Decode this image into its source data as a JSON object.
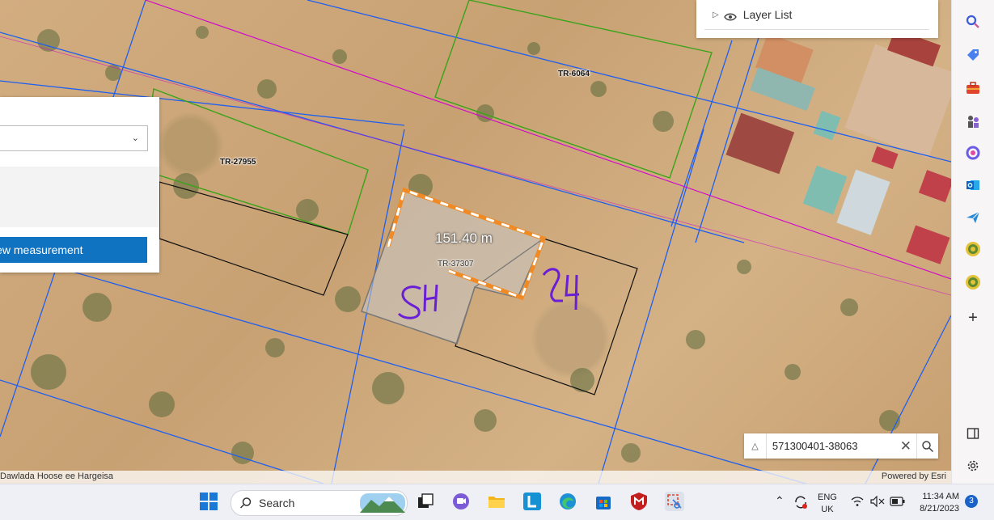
{
  "layer_panel": {
    "title": "Layer List"
  },
  "measure_panel": {
    "button_label": "New measurement"
  },
  "map": {
    "parcels": [
      "TR-6064",
      "TR-27955",
      "TR-37307"
    ],
    "measurement": "151.40 m",
    "annotations": [
      "SH",
      "24"
    ]
  },
  "attribution": {
    "left": "Dawlada Hoose ee Hargeisa",
    "right": "Powered by Esri"
  },
  "search": {
    "value": "571300401-38063"
  },
  "right_toolbar": {
    "icons": [
      "search-icon",
      "tag-icon",
      "briefcase-icon",
      "chess-icon",
      "office-icon",
      "outlook-icon",
      "send-icon",
      "emblem-icon",
      "emblem-icon",
      "plus-icon",
      "sidebar-icon",
      "gear-icon"
    ]
  },
  "taskbar": {
    "search_label": "Search",
    "language": {
      "line1": "ENG",
      "line2": "UK"
    },
    "time": "11:34 AM",
    "date": "8/21/2023",
    "notification_count": "3"
  }
}
